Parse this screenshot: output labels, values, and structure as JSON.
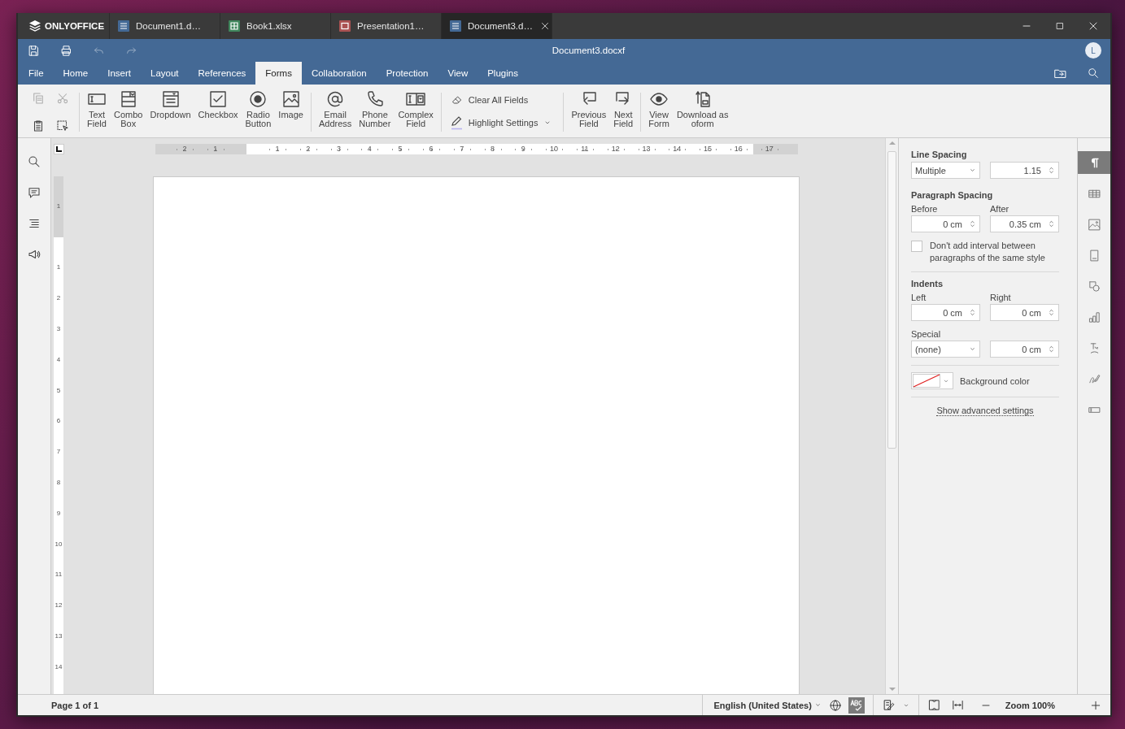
{
  "brand": {
    "label": "ONLYOFFICE"
  },
  "doc_tabs": [
    {
      "label": "Document1.d…",
      "kind": "document",
      "selected": false
    },
    {
      "label": "Book1.xlsx",
      "kind": "spreadsheet",
      "selected": false
    },
    {
      "label": "Presentation1…",
      "kind": "presentation",
      "selected": false
    },
    {
      "label": "Document3.d…",
      "kind": "document",
      "selected": true
    }
  ],
  "title": "Document3.docxf",
  "quick_access": [
    {
      "kind": "save",
      "disabled": false
    },
    {
      "kind": "print",
      "disabled": false
    },
    {
      "kind": "undo",
      "disabled": true
    },
    {
      "kind": "redo",
      "disabled": true
    }
  ],
  "user": {
    "initial": "L"
  },
  "menu_tabs": [
    {
      "label": "File",
      "selected": false
    },
    {
      "label": "Home",
      "selected": false
    },
    {
      "label": "Insert",
      "selected": false
    },
    {
      "label": "Layout",
      "selected": false
    },
    {
      "label": "References",
      "selected": false
    },
    {
      "label": "Forms",
      "selected": true
    },
    {
      "label": "Collaboration",
      "selected": false
    },
    {
      "label": "Protection",
      "selected": false
    },
    {
      "label": "View",
      "selected": false
    },
    {
      "label": "Plugins",
      "selected": false
    }
  ],
  "ribbon": {
    "clipboard": [
      {
        "kind": "copy",
        "disabled": true
      },
      {
        "kind": "cut",
        "disabled": true
      },
      {
        "kind": "paste",
        "disabled": false
      },
      {
        "kind": "select",
        "disabled": false
      }
    ],
    "groups": [
      {
        "kind": "large",
        "buttons": [
          {
            "label": "Text\nField",
            "kind": "text-field"
          },
          {
            "label": "Combo\nBox",
            "kind": "combo-box"
          },
          {
            "label": "Dropdown",
            "kind": "dropdown"
          },
          {
            "label": "Checkbox",
            "kind": "checkbox"
          },
          {
            "label": "Radio\nButton",
            "kind": "radio"
          },
          {
            "label": "Image",
            "kind": "image"
          }
        ]
      },
      {
        "kind": "large",
        "buttons": [
          {
            "label": "Email\nAddress",
            "kind": "email"
          },
          {
            "label": "Phone\nNumber",
            "kind": "phone"
          },
          {
            "label": "Complex\nField",
            "kind": "complex"
          }
        ]
      },
      {
        "kind": "small",
        "buttons": [
          {
            "label": "Clear All Fields",
            "kind": "clear"
          },
          {
            "label": "Highlight Settings",
            "kind": "highlight"
          }
        ]
      },
      {
        "kind": "large",
        "buttons": [
          {
            "label": "Previous\nField",
            "kind": "previous"
          },
          {
            "label": "Next\nField",
            "kind": "next"
          }
        ]
      },
      {
        "kind": "large",
        "buttons": [
          {
            "label": "View\nForm",
            "kind": "view"
          },
          {
            "label": "Download as\noform",
            "kind": "download"
          }
        ]
      }
    ]
  },
  "left_bar": [
    {
      "kind": "search"
    },
    {
      "kind": "comment"
    },
    {
      "kind": "headings"
    },
    {
      "kind": "feedback"
    }
  ],
  "ruler": {
    "top_margin_labels": [
      "2",
      "1"
    ],
    "top_labels": [
      "1",
      "2",
      "3",
      "4",
      "5",
      "6",
      "7",
      "8",
      "9",
      "10",
      "11",
      "12",
      "13",
      "14",
      "15",
      "16",
      "17"
    ],
    "side_margin_labels": [
      "1"
    ],
    "side_labels": [
      "1",
      "2",
      "3",
      "4",
      "5",
      "6",
      "7",
      "8",
      "9",
      "10",
      "11",
      "12",
      "13",
      "14"
    ]
  },
  "paragraph_settings": {
    "line_spacing": {
      "label": "Line Spacing",
      "mode": "Multiple",
      "value": "1.15"
    },
    "paragraph_spacing": {
      "label": "Paragraph Spacing",
      "before_label": "Before",
      "before": "0 cm",
      "after_label": "After",
      "after": "0.35 cm"
    },
    "no_interval": {
      "label": "Don't add interval between paragraphs of the same style",
      "checked": false
    },
    "indents": {
      "label": "Indents",
      "left_label": "Left",
      "left": "0 cm",
      "right_label": "Right",
      "right": "0 cm",
      "special_label": "Special",
      "special": "(none)",
      "special_value": "0 cm"
    },
    "background": {
      "label": "Background color"
    },
    "advanced_link": "Show advanced settings"
  },
  "right_bar": [
    {
      "kind": "paragraph",
      "selected": true
    },
    {
      "kind": "table",
      "selected": false
    },
    {
      "kind": "image",
      "selected": false
    },
    {
      "kind": "header-footer",
      "selected": false
    },
    {
      "kind": "shape",
      "selected": false
    },
    {
      "kind": "chart",
      "selected": false
    },
    {
      "kind": "text-art",
      "selected": false
    },
    {
      "kind": "signature",
      "selected": false
    },
    {
      "kind": "form",
      "selected": false
    }
  ],
  "status_bar": {
    "page": "Page 1 of 1",
    "language": "English (United States)",
    "spellcheck_on": true,
    "zoom": "Zoom 100%"
  }
}
